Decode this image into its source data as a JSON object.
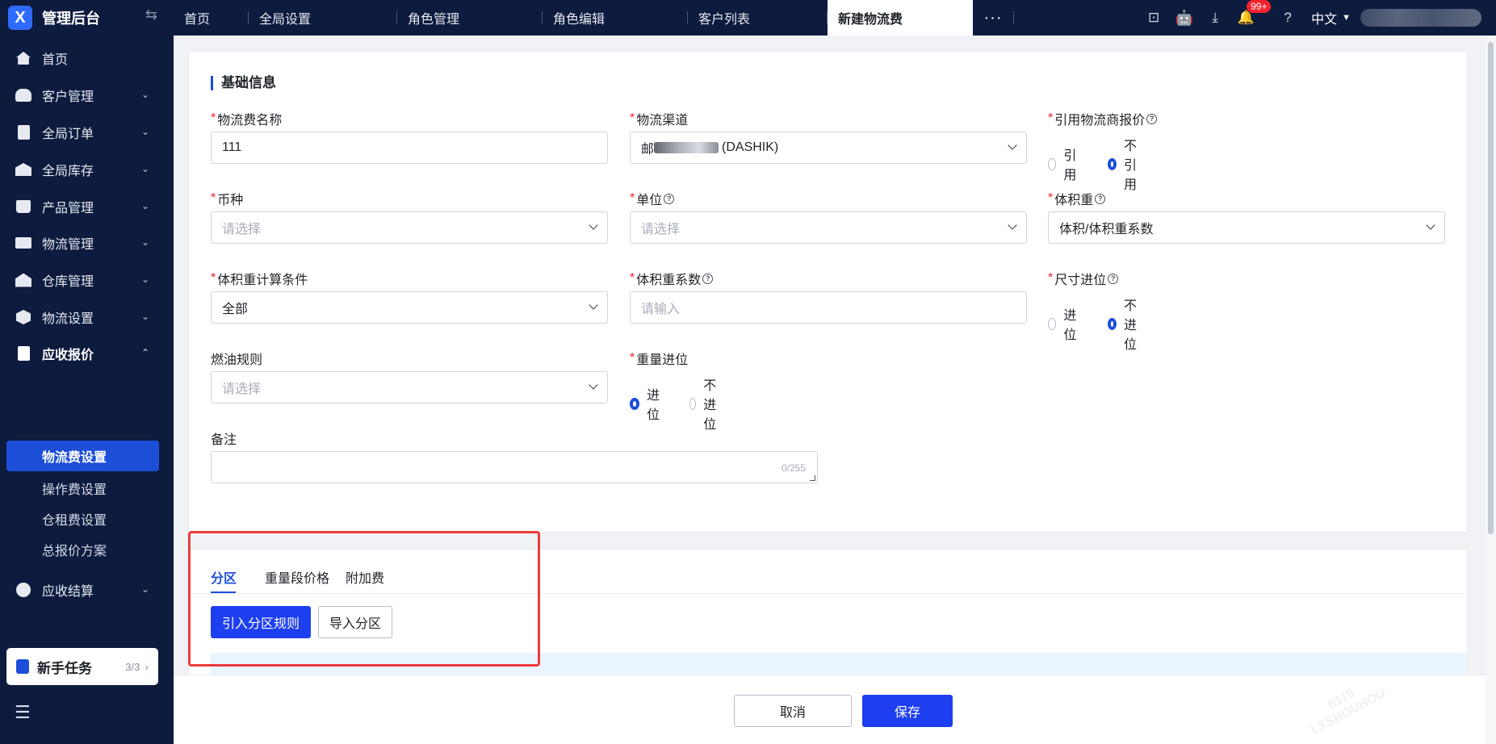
{
  "app": {
    "title": "管理后台",
    "logo_letter": "X"
  },
  "tabs": [
    {
      "label": "首页"
    },
    {
      "label": "全局设置"
    },
    {
      "label": "角色管理"
    },
    {
      "label": "角色编辑"
    },
    {
      "label": "客户列表"
    },
    {
      "label": "新建物流费"
    }
  ],
  "tabs_more": "···",
  "topbar": {
    "notification_badge": "99+",
    "language": "中文"
  },
  "sidebar": {
    "menu": [
      {
        "label": "首页",
        "icon": "home-icon"
      },
      {
        "label": "客户管理",
        "icon": "users-icon"
      },
      {
        "label": "全局订单",
        "icon": "document-icon"
      },
      {
        "label": "全局库存",
        "icon": "warehouse-icon"
      },
      {
        "label": "产品管理",
        "icon": "bag-icon"
      },
      {
        "label": "物流管理",
        "icon": "truck-icon"
      },
      {
        "label": "仓库管理",
        "icon": "house-icon"
      },
      {
        "label": "物流设置",
        "icon": "cube-icon"
      },
      {
        "label": "应收报价",
        "icon": "document-icon"
      },
      {
        "label": "应收结算",
        "icon": "coin-icon"
      }
    ],
    "submenu": [
      {
        "label": "物流费设置"
      },
      {
        "label": "操作费设置"
      },
      {
        "label": "仓租费设置"
      },
      {
        "label": "总报价方案"
      }
    ],
    "task": {
      "title": "新手任务",
      "count": "3/3"
    }
  },
  "form": {
    "section_title": "基础信息",
    "name": {
      "label": "物流费名称",
      "value": "111"
    },
    "channel": {
      "label": "物流渠道",
      "value_prefix": "邮",
      "value_suffix": "(DASHIK)"
    },
    "ref_quote": {
      "label": "引用物流商报价",
      "options": [
        "引用",
        "不引用"
      ],
      "selected": "不引用"
    },
    "currency": {
      "label": "币种",
      "placeholder": "请选择"
    },
    "unit": {
      "label": "单位",
      "placeholder": "请选择"
    },
    "vol_weight": {
      "label": "体积重",
      "value": "体积/体积重系数"
    },
    "vol_cond": {
      "label": "体积重计算条件",
      "value": "全部"
    },
    "vol_coef": {
      "label": "体积重系数",
      "placeholder": "请输入"
    },
    "size_carry": {
      "label": "尺寸进位",
      "options": [
        "进位",
        "不进位"
      ],
      "selected": "不进位"
    },
    "fuel_rule": {
      "label": "燃油规则",
      "placeholder": "请选择"
    },
    "weight_carry": {
      "label": "重量进位",
      "options": [
        "进位",
        "不进位"
      ],
      "selected": "进位"
    },
    "remark": {
      "label": "备注",
      "counter": "0/255"
    }
  },
  "pricing_tabs": [
    {
      "label": "分区"
    },
    {
      "label": "重量段价格"
    },
    {
      "label": "附加费"
    }
  ],
  "actions": {
    "import_rule": "引入分区规则",
    "import_zone": "导入分区"
  },
  "footer": {
    "cancel": "取消",
    "save": "保存"
  },
  "watermark": {
    "line1": "8119",
    "line2": "LXSHOUHOU"
  },
  "colors": {
    "primary": "#1d3ff0",
    "sidebar_bg": "#0d1b3e",
    "required": "#f5222d",
    "highlight": "#ef3b3b"
  }
}
